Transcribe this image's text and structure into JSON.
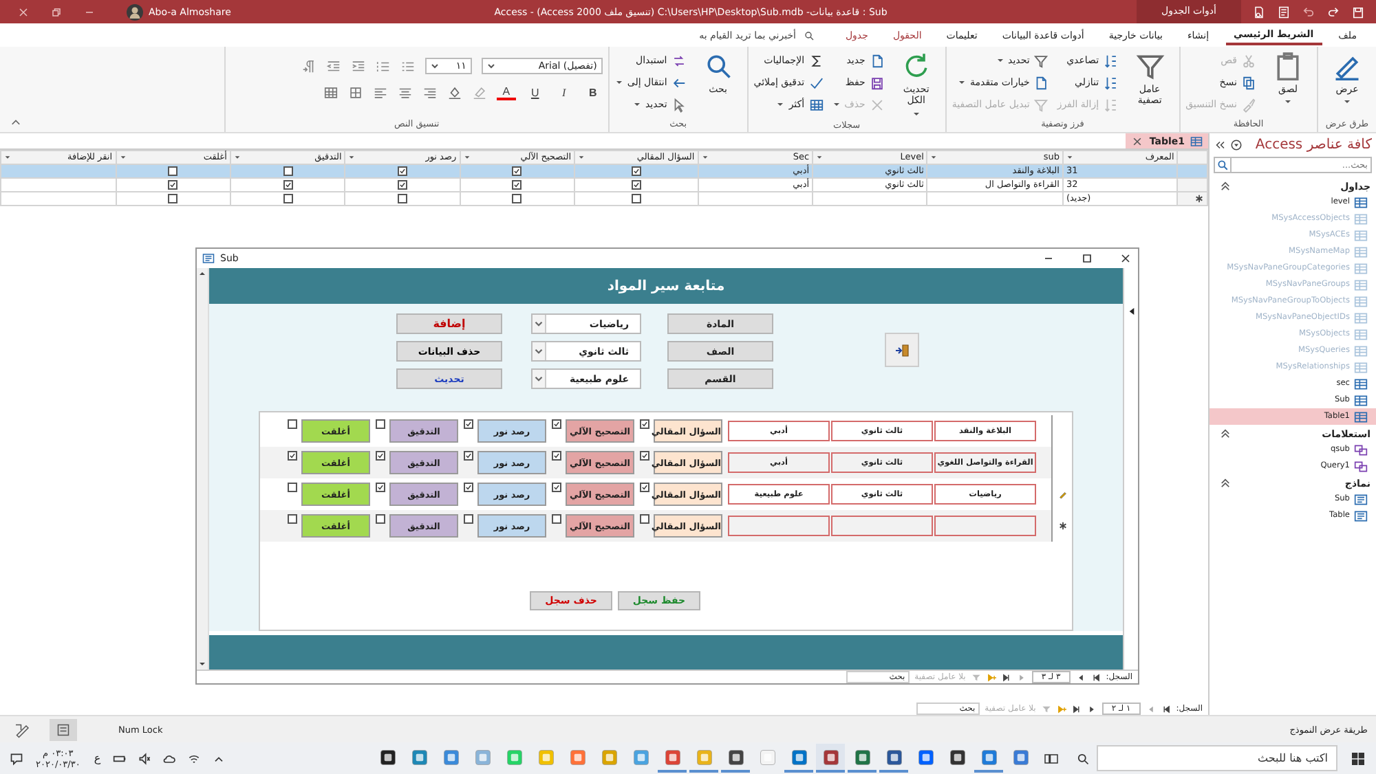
{
  "window": {
    "title": "Sub : قاعدة بيانات- C:\\Users\\HP\\Desktop\\Sub.mdb (تنسيق ملف Access 2000) - Access",
    "context_tab": "أدوات الجدول",
    "user": "Abo-a Almoshare"
  },
  "ribbon_tabs": [
    {
      "label": "ملف",
      "selected": false,
      "kind": "normal"
    },
    {
      "label": "الشريط الرئيسي",
      "selected": true,
      "kind": "normal"
    },
    {
      "label": "إنشاء",
      "selected": false,
      "kind": "normal"
    },
    {
      "label": "بيانات خارجية",
      "selected": false,
      "kind": "normal"
    },
    {
      "label": "أدوات قاعدة البيانات",
      "selected": false,
      "kind": "normal"
    },
    {
      "label": "تعليمات",
      "selected": false,
      "kind": "normal"
    },
    {
      "label": "الحقول",
      "selected": false,
      "kind": "context"
    },
    {
      "label": "جدول",
      "selected": false,
      "kind": "context"
    }
  ],
  "tell_me": {
    "placeholder": "أخبرني بما تريد القيام به"
  },
  "ribbon_groups": [
    {
      "title": "طرق عرض",
      "columns": [
        [
          {
            "label": "عرض",
            "kind": "large",
            "disabled": false,
            "menu": true
          }
        ]
      ]
    },
    {
      "title": "الحافظة",
      "columns": [
        [
          {
            "label": "لصق",
            "kind": "large",
            "disabled": false,
            "menu": true
          }
        ],
        [
          {
            "label": "قص",
            "kind": "small",
            "disabled": true,
            "menu": false
          },
          {
            "label": "نسخ",
            "kind": "small",
            "disabled": false,
            "menu": false
          },
          {
            "label": "نسخ التنسيق",
            "kind": "small",
            "disabled": true,
            "menu": false
          }
        ]
      ]
    },
    {
      "title": "فرز وتصفية",
      "columns": [
        [
          {
            "label": "عامل تصفية",
            "kind": "large",
            "disabled": false,
            "menu": false
          }
        ],
        [
          {
            "label": "تصاعدي",
            "kind": "small",
            "disabled": false,
            "menu": false
          },
          {
            "label": "تنازلي",
            "kind": "small",
            "disabled": false,
            "menu": false
          },
          {
            "label": "إزالة الفرز",
            "kind": "small",
            "disabled": true,
            "menu": false
          }
        ],
        [
          {
            "label": "تحديد",
            "kind": "small",
            "disabled": false,
            "menu": true
          },
          {
            "label": "خيارات متقدمة",
            "kind": "small",
            "disabled": false,
            "menu": true
          },
          {
            "label": "تبديل عامل التصفية",
            "kind": "small",
            "disabled": true,
            "menu": false
          }
        ]
      ]
    },
    {
      "title": "سجلات",
      "columns": [
        [
          {
            "label": "تحديث الكل",
            "kind": "large",
            "disabled": false,
            "menu": true
          }
        ],
        [
          {
            "label": "جديد",
            "kind": "small",
            "disabled": false,
            "menu": false
          },
          {
            "label": "حفظ",
            "kind": "small",
            "disabled": false,
            "menu": false
          },
          {
            "label": "حذف",
            "kind": "small",
            "disabled": true,
            "menu": true
          }
        ],
        [
          {
            "label": "الإجماليات",
            "kind": "small",
            "disabled": false,
            "menu": false
          },
          {
            "label": "تدقيق إملائي",
            "kind": "small",
            "disabled": false,
            "menu": false
          },
          {
            "label": "أكثر",
            "kind": "small",
            "disabled": false,
            "menu": true
          }
        ]
      ]
    },
    {
      "title": "بحث",
      "columns": [
        [
          {
            "label": "بحث",
            "kind": "large",
            "disabled": false,
            "menu": false
          }
        ],
        [
          {
            "label": "استبدال",
            "kind": "small",
            "disabled": false,
            "menu": false
          },
          {
            "label": "انتقال إلى",
            "kind": "small",
            "disabled": false,
            "menu": true
          },
          {
            "label": "تحديد",
            "kind": "small",
            "disabled": false,
            "menu": true
          }
        ]
      ]
    }
  ],
  "text_format": {
    "title": "تنسيق النص",
    "font": "(تفصيل) Arial",
    "size": "١١",
    "buttons": [
      "B",
      "I",
      "U"
    ],
    "font_color": "A"
  },
  "table": {
    "tab": "Table1",
    "columns": [
      "المعرف",
      "sub",
      "Level",
      "Sec",
      "السؤال المقالي",
      "التصحيح الآلي",
      "رصد نور",
      "التدقيق",
      "أغلقت",
      "انقر للإضافة"
    ],
    "rows": [
      {
        "kind": "record",
        "cells": [
          "31",
          "البلاغة والنقد",
          "ثالث ثانوي",
          "أدبي"
        ],
        "checks": [
          true,
          true,
          true,
          false,
          false
        ],
        "selected": true
      },
      {
        "kind": "record",
        "cells": [
          "32",
          "القراءة والتواصل ال",
          "ثالث ثانوي",
          "أدبي"
        ],
        "checks": [
          true,
          true,
          true,
          true,
          true
        ],
        "selected": false
      },
      {
        "kind": "new",
        "cells": [
          "(جديد)"
        ],
        "checks": [
          false,
          false,
          false,
          false,
          false
        ],
        "selected": false
      }
    ],
    "record_nav": {
      "label": "السجل:",
      "position": "١ لـ ٢",
      "filter": "بلا عامل تصفية",
      "search": "بحث"
    }
  },
  "form": {
    "title": "Sub",
    "header": "متابعة سير المواد",
    "filters": [
      {
        "label": "المادة",
        "value": "رياضيات"
      },
      {
        "label": "الصف",
        "value": "ثالث ثانوي"
      },
      {
        "label": "القسم",
        "value": "علوم طبيعية"
      }
    ],
    "actions": [
      {
        "label": "إضافة",
        "kind": "add"
      },
      {
        "label": "حذف البيانات",
        "kind": "delete"
      },
      {
        "label": "تحديث",
        "kind": "refresh"
      }
    ],
    "rows": [
      {
        "kind": "saved",
        "fields": [
          "البلاغة والنقد",
          "ثالث ثانوي",
          "أدبي"
        ],
        "actions": [
          {
            "label": "السؤال المقالي",
            "checked": true
          },
          {
            "label": "التصحيح الآلي",
            "checked": true
          },
          {
            "label": "رصد نور",
            "checked": true
          },
          {
            "label": "التدقيق",
            "checked": false
          },
          {
            "label": "أغلقت",
            "checked": false
          }
        ]
      },
      {
        "kind": "saved",
        "fields": [
          "القراءة والتواصل اللغوي",
          "ثالث ثانوي",
          "أدبي"
        ],
        "actions": [
          {
            "label": "السؤال المقالي",
            "checked": true
          },
          {
            "label": "التصحيح الآلي",
            "checked": true
          },
          {
            "label": "رصد نور",
            "checked": true
          },
          {
            "label": "التدقيق",
            "checked": true
          },
          {
            "label": "أغلقت",
            "checked": true
          }
        ]
      },
      {
        "kind": "editing",
        "fields": [
          "رياضيات",
          "ثالث ثانوي",
          "علوم طبيعية"
        ],
        "actions": [
          {
            "label": "السؤال المقالي",
            "checked": true
          },
          {
            "label": "التصحيح الآلي",
            "checked": true
          },
          {
            "label": "رصد نور",
            "checked": true
          },
          {
            "label": "التدقيق",
            "checked": true
          },
          {
            "label": "أغلقت",
            "checked": false
          }
        ]
      },
      {
        "kind": "new",
        "actions": [
          {
            "label": "السؤال المقالي",
            "checked": false
          },
          {
            "label": "التصحيح الآلي",
            "checked": false
          },
          {
            "label": "رصد نور",
            "checked": false
          },
          {
            "label": "التدقيق",
            "checked": false
          },
          {
            "label": "أغلقت",
            "checked": false
          }
        ]
      }
    ],
    "buttons": [
      {
        "label": "حفظ سجل",
        "kind": "save"
      },
      {
        "label": "حذف سجل",
        "kind": "delete"
      }
    ],
    "record_nav": {
      "label": "السجل:",
      "position": "٣ لـ ٣",
      "filter": "بلا عامل تصفية",
      "search": "بحث"
    }
  },
  "nav": {
    "title": "كافة عناصر Access",
    "search": {
      "placeholder": "بحث..."
    },
    "groups": [
      {
        "label": "جداول",
        "kind": "tables",
        "items": [
          {
            "label": "level",
            "dimmed": false,
            "selected": false
          },
          {
            "label": "MSysAccessObjects",
            "dimmed": true,
            "selected": false
          },
          {
            "label": "MSysACEs",
            "dimmed": true,
            "selected": false
          },
          {
            "label": "MSysNameMap",
            "dimmed": true,
            "selected": false
          },
          {
            "label": "MSysNavPaneGroupCategories",
            "dimmed": true,
            "selected": false
          },
          {
            "label": "MSysNavPaneGroups",
            "dimmed": true,
            "selected": false
          },
          {
            "label": "MSysNavPaneGroupToObjects",
            "dimmed": true,
            "selected": false
          },
          {
            "label": "MSysNavPaneObjectIDs",
            "dimmed": true,
            "selected": false
          },
          {
            "label": "MSysObjects",
            "dimmed": true,
            "selected": false
          },
          {
            "label": "MSysQueries",
            "dimmed": true,
            "selected": false
          },
          {
            "label": "MSysRelationships",
            "dimmed": true,
            "selected": false
          },
          {
            "label": "sec",
            "dimmed": false,
            "selected": false
          },
          {
            "label": "Sub",
            "dimmed": false,
            "selected": false
          },
          {
            "label": "Table1",
            "dimmed": false,
            "selected": true
          }
        ]
      },
      {
        "label": "استعلامات",
        "kind": "queries",
        "items": [
          {
            "label": "qsub",
            "dimmed": false,
            "selected": false
          },
          {
            "label": "Query1",
            "dimmed": false,
            "selected": false
          }
        ]
      },
      {
        "label": "نماذج",
        "kind": "forms",
        "items": [
          {
            "label": "Sub",
            "dimmed": false,
            "selected": false
          },
          {
            "label": "Table",
            "dimmed": false,
            "selected": false
          }
        ]
      }
    ]
  },
  "status_bar": {
    "view": "طريقة عرض النموذج",
    "indicator": "Num Lock"
  },
  "taskbar": {
    "search": {
      "placeholder": "اكتب هنا للبحث"
    },
    "language": "ع",
    "time": "٠٣:٠٣ م",
    "date": "٢٠٢٠/٠٣/٣٠",
    "apps": [
      {
        "running": false,
        "selected": false
      },
      {
        "running": true,
        "selected": false
      },
      {
        "running": false,
        "selected": false
      },
      {
        "running": false,
        "selected": false
      },
      {
        "running": true,
        "selected": false
      },
      {
        "running": true,
        "selected": false
      },
      {
        "running": true,
        "selected": true
      },
      {
        "running": true,
        "selected": false
      },
      {
        "running": false,
        "selected": false
      },
      {
        "running": true,
        "selected": false
      },
      {
        "running": true,
        "selected": false
      },
      {
        "running": true,
        "selected": false
      },
      {
        "running": false,
        "selected": false
      },
      {
        "running": false,
        "selected": false
      },
      {
        "running": false,
        "selected": false
      },
      {
        "running": false,
        "selected": false
      },
      {
        "running": false,
        "selected": false
      },
      {
        "running": false,
        "selected": false
      },
      {
        "running": false,
        "selected": false
      },
      {
        "running": false,
        "selected": false
      },
      {
        "running": false,
        "selected": false
      }
    ]
  }
}
